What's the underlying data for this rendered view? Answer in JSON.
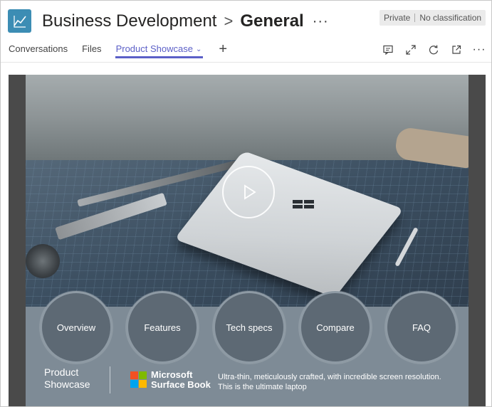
{
  "header": {
    "team_name": "Business Development",
    "separator": ">",
    "channel_name": "General",
    "more": "···",
    "privacy": "Private",
    "classification": "No classification"
  },
  "tabs": [
    {
      "label": "Conversations"
    },
    {
      "label": "Files"
    },
    {
      "label": "Product Showcase",
      "active": true
    }
  ],
  "add_tab": "+",
  "toolbar": {
    "icons": [
      "chat-icon",
      "expand-icon",
      "refresh-icon",
      "open-external-icon",
      "more-options-icon"
    ],
    "more": "···"
  },
  "showcase": {
    "nav": [
      "Overview",
      "Features",
      "Tech specs",
      "Compare",
      "FAQ"
    ],
    "title_line1": "Product",
    "title_line2": "Showcase",
    "brand_line1": "Microsoft",
    "brand_line2": "Surface Book",
    "tagline_line1": "Ultra-thin, meticulously crafted, with incredible screen resolution.",
    "tagline_line2": "This is the ultimate laptop"
  },
  "colors": {
    "accent": "#5b5fc7",
    "team_icon": "#3c8db4",
    "panel": "#7e8b96",
    "ms_red": "#f25022",
    "ms_green": "#7fba00",
    "ms_blue": "#00a4ef",
    "ms_yellow": "#ffb900"
  }
}
